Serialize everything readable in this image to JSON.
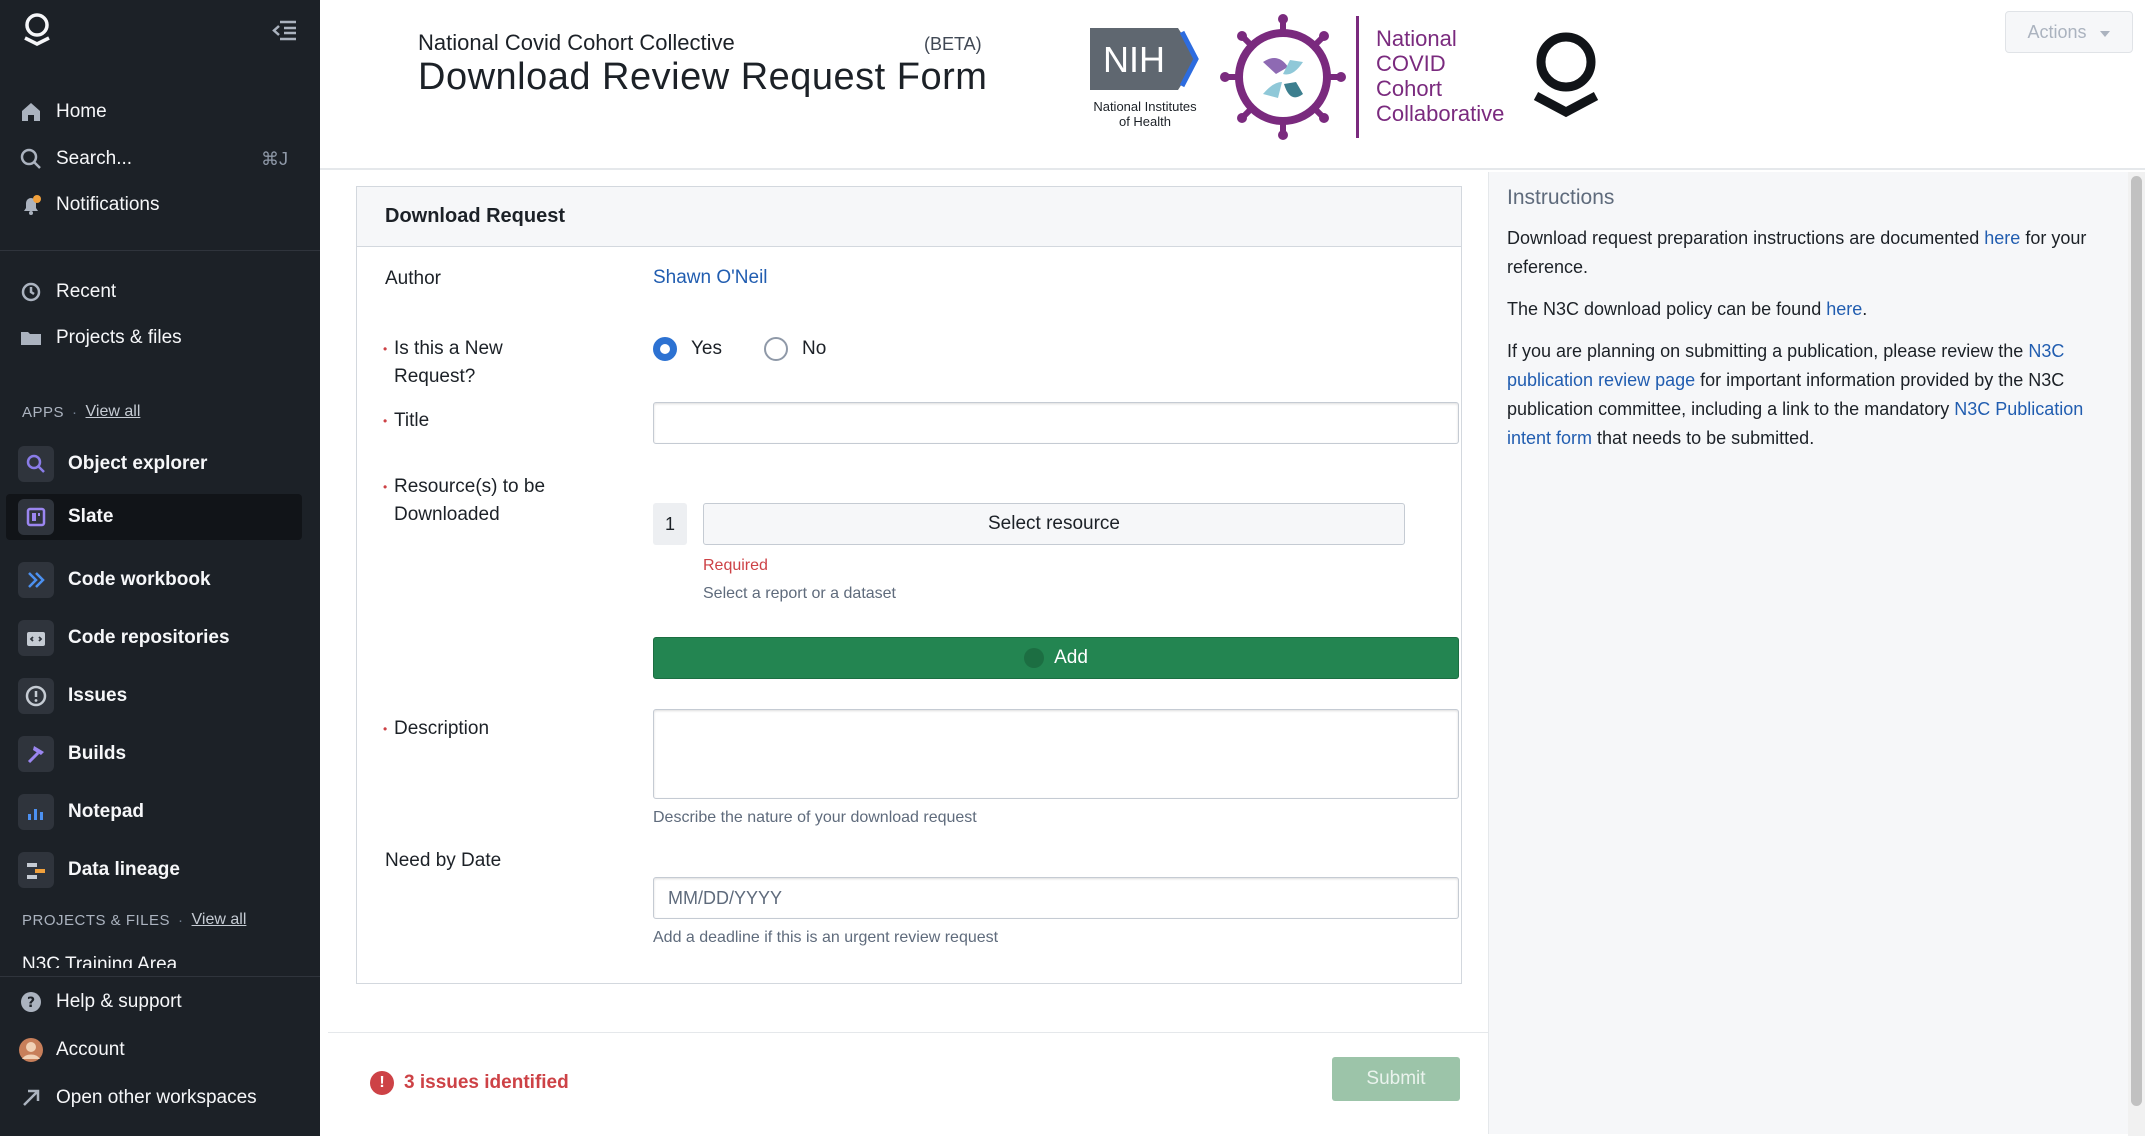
{
  "sidebar": {
    "nav_top": [
      {
        "label": "Home",
        "icon": "home-icon"
      },
      {
        "label": "Search...",
        "icon": "search-icon",
        "shortcut": "⌘J"
      },
      {
        "label": "Notifications",
        "icon": "bell-icon"
      }
    ],
    "nav_mid": [
      {
        "label": "Recent",
        "icon": "history-icon"
      },
      {
        "label": "Projects & files",
        "icon": "folder-icon"
      }
    ],
    "apps_heading": "APPS",
    "apps_view_all": "View all",
    "apps": [
      {
        "label": "Object explorer",
        "icon": "object-explorer-icon"
      },
      {
        "label": "Slate",
        "icon": "slate-icon"
      },
      {
        "label": "Code workbook",
        "icon": "code-workbook-icon"
      },
      {
        "label": "Code repositories",
        "icon": "code-repositories-icon"
      },
      {
        "label": "Issues",
        "icon": "issues-icon"
      },
      {
        "label": "Builds",
        "icon": "builds-icon"
      },
      {
        "label": "Notepad",
        "icon": "notepad-icon"
      },
      {
        "label": "Data lineage",
        "icon": "data-lineage-icon"
      }
    ],
    "projects_heading": "PROJECTS & FILES",
    "projects_view_all": "View all",
    "projects_cut_item": "N3C Training Area",
    "nav_bottom": [
      {
        "label": "Help & support",
        "icon": "help-icon"
      },
      {
        "label": "Account",
        "icon": "avatar-icon"
      },
      {
        "label": "Open other workspaces",
        "icon": "arrow-up-right-icon"
      }
    ]
  },
  "header": {
    "org": "National Covid Cohort Collective",
    "beta": "(BETA)",
    "title": "Download Review Request Form",
    "nih_mark": "NIH",
    "nih_caption_1": "National Institutes",
    "nih_caption_2": "of Health",
    "n3c_lines": [
      "National",
      "COVID",
      "Cohort",
      "Collaborative"
    ],
    "actions_label": "Actions"
  },
  "form": {
    "card_title": "Download Request",
    "author_label": "Author",
    "author_value": "Shawn O'Neil",
    "new_request_label_1": "Is this a New",
    "new_request_label_2": "Request?",
    "yes_label": "Yes",
    "no_label": "No",
    "title_label": "Title",
    "resources_label_1": "Resource(s) to be",
    "resources_label_2": "Downloaded",
    "resource_index": "1",
    "select_resource_label": "Select resource",
    "required_msg": "Required",
    "resource_helper": "Select a report or a dataset",
    "add_label": "Add",
    "description_label": "Description",
    "description_helper": "Describe the nature of your download request",
    "need_by_label": "Need by Date",
    "date_placeholder": "MM/DD/YYYY",
    "date_helper": "Add a deadline if this is an urgent review request"
  },
  "footer": {
    "issues_text": "3 issues identified",
    "submit_label": "Submit"
  },
  "instructions": {
    "title": "Instructions",
    "p1_a": "Download request preparation instructions are documented ",
    "p1_link": "here",
    "p1_b": " for your reference.",
    "p2_a": "The N3C download policy can be found ",
    "p2_link": "here",
    "p2_b": ".",
    "p3_a": "If you are planning on submitting a publication, please review the ",
    "p3_link1": "N3C publication review page",
    "p3_b": " for important information provided by the N3C publication committee, including a link to the mandatory ",
    "p3_link2": "N3C Publication intent form",
    "p3_c": " that needs to be submitted."
  },
  "colors": {
    "sidebar_bg": "#1c2127",
    "link": "#215db0",
    "add_button": "#238551",
    "error": "#cd4246",
    "n3c_purple": "#7a2a7e"
  }
}
